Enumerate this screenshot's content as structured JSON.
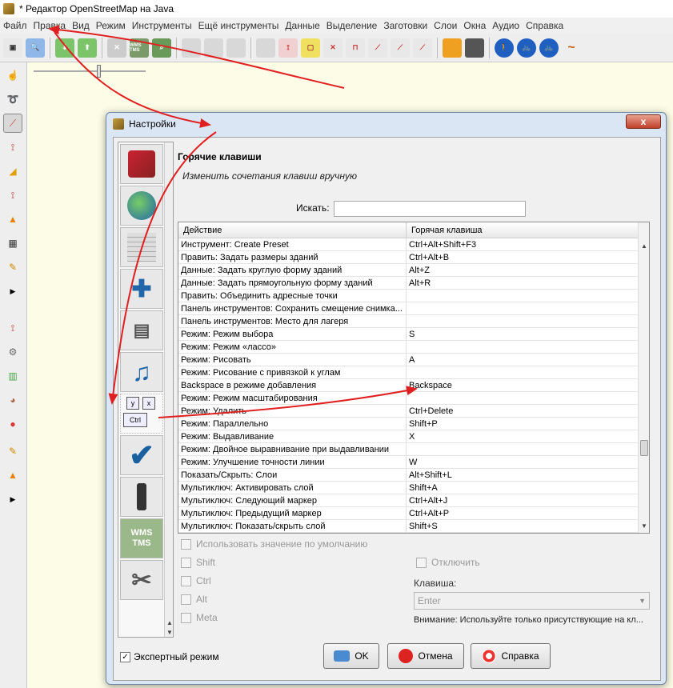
{
  "window": {
    "title": "* Редактор OpenStreetMap на Java"
  },
  "menu": [
    "Файл",
    "Правка",
    "Вид",
    "Режим",
    "Инструменты",
    "Ещё инструменты",
    "Данные",
    "Выделение",
    "Заготовки",
    "Слои",
    "Окна",
    "Аудио",
    "Справка"
  ],
  "toolbar": {
    "icons": [
      "open-file-icon",
      "zoom-icon",
      "download-icon",
      "upload-icon",
      "select-icon",
      "wms-icon",
      "search-icon",
      "layer-icon",
      "layer-icon",
      "layer-icon",
      "copy-icon",
      "split-icon",
      "square-icon",
      "combine-icon",
      "distribute-icon",
      "reverse-icon",
      "align-icon",
      "simplify-icon",
      "road-icon",
      "rail-icon",
      "footpath-icon",
      "cycleway-icon",
      "bridleway-icon",
      "path-icon"
    ],
    "wms_label": "WMS TMS"
  },
  "map": {
    "lefttools": [
      "select-icon",
      "lasso-icon",
      "draw-icon",
      "improve-way-icon",
      "angle-icon",
      "extrude-icon",
      "parallel-icon",
      "building-icon",
      "pencil-icon",
      "expand-icon",
      "zoom-icon",
      "settings-icon",
      "map-icon",
      "palette-icon",
      "marker-icon",
      "notes-icon",
      "chart-icon",
      "expand-icon"
    ]
  },
  "dialog": {
    "title": "Настройки",
    "close_label": "x",
    "heading": "Горячие клавиши",
    "subheading": "Изменить сочетания клавиш вручную",
    "search_label": "Искать:",
    "search_value": "",
    "columns": [
      "Действие",
      "Горячая клавиша"
    ],
    "rows": [
      [
        "Инструмент: Create Preset",
        "Ctrl+Alt+Shift+F3"
      ],
      [
        "Править: Задать размеры зданий",
        "Ctrl+Alt+B"
      ],
      [
        "Данные: Задать круглую форму зданий",
        "Alt+Z"
      ],
      [
        "Данные: Задать прямоугольную форму зданий",
        "Alt+R"
      ],
      [
        "Править: Объединить адресные точки",
        ""
      ],
      [
        "Панель инструментов: Сохранить смещение снимка...",
        ""
      ],
      [
        "Панель инструментов: Место для лагеря",
        ""
      ],
      [
        "Режим: Режим выбора",
        "S"
      ],
      [
        "Режим: Режим «лассо»",
        ""
      ],
      [
        "Режим: Рисовать",
        "A"
      ],
      [
        "Режим: Рисование с привязкой к углам",
        ""
      ],
      [
        "Backspace в режиме добавления",
        "Backspace"
      ],
      [
        "Режим: Режим масштабирования",
        ""
      ],
      [
        "Режим: Удалить",
        "Ctrl+Delete"
      ],
      [
        "Режим: Параллельно",
        "Shift+P"
      ],
      [
        "Режим: Выдавливание",
        "X"
      ],
      [
        "Режим: Двойное выравнивание при выдавливании",
        ""
      ],
      [
        "Режим: Улучшение точности линии",
        "W"
      ],
      [
        "Показать/Скрыть: Слои",
        "Alt+Shift+L"
      ],
      [
        "Мультиключ: Активировать слой",
        "Shift+A"
      ],
      [
        "Мультиключ: Следующий маркер",
        "Ctrl+Alt+J"
      ],
      [
        "Мультиключ: Предыдущий маркер",
        "Ctrl+Alt+P"
      ],
      [
        "Мультиключ: Показать/скрыть слой",
        "Shift+S"
      ]
    ],
    "use_default": "Использовать значение по умолчанию",
    "shift": "Shift",
    "ctrl": "Ctrl",
    "alt": "Alt",
    "meta": "Meta",
    "disable": "Отключить",
    "key_label": "Клавиша:",
    "key_value": "Enter",
    "warning": "Внимание: Используйте только присутствующие на кл...",
    "expert_mode": "Экспертный режим",
    "ok": "OK",
    "cancel": "Отмена",
    "help": "Справка",
    "tabs": [
      "display-tab-icon",
      "map-tab-icon",
      "projection-tab-icon",
      "plugins-tab-icon",
      "remote-tab-icon",
      "audio-tab-icon",
      "shortcuts-tab-icon",
      "validator-tab-icon",
      "remote-control-tab-icon",
      "wms-tab-icon",
      "advanced-tab-icon"
    ],
    "shortcut_tab_keys": {
      "top_left": "y",
      "top_right": "x",
      "bottom": "Ctrl"
    },
    "wms_tab_label": "WMS TMS"
  },
  "colors": {
    "arrow": "#e02020",
    "map_bg": "#fdfce6",
    "accent": "#1f5fbf"
  }
}
